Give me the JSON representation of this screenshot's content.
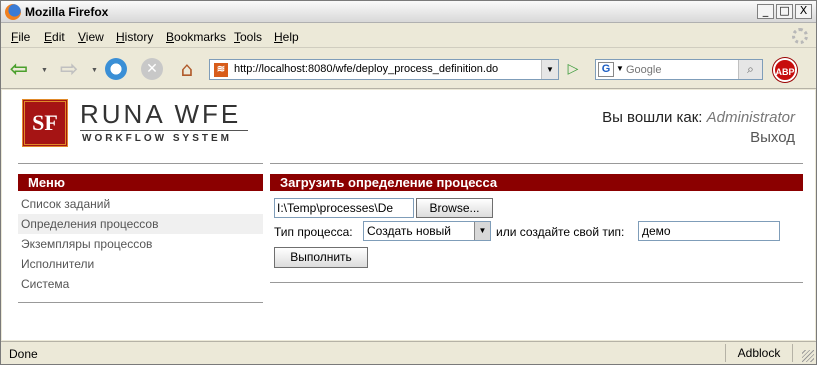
{
  "window": {
    "title": "Mozilla Firefox",
    "min": "_",
    "max": "□",
    "close": "X"
  },
  "menu": [
    {
      "label": "File",
      "key": "F",
      "rest": "ile"
    },
    {
      "label": "Edit",
      "key": "E",
      "rest": "dit"
    },
    {
      "label": "View",
      "key": "V",
      "rest": "iew"
    },
    {
      "label": "History",
      "key": "H",
      "rest": "istory"
    },
    {
      "label": "Bookmarks",
      "key": "B",
      "rest": "ookmarks"
    },
    {
      "label": "Tools",
      "key": "T",
      "rest": "ools"
    },
    {
      "label": "Help",
      "key": "H",
      "rest": "elp"
    }
  ],
  "nav": {
    "url": "http://localhost:8080/wfe/deploy_process_definition.do",
    "search_placeholder": "Google",
    "search_engine_letter": "G",
    "abp": "ABP"
  },
  "logo": {
    "mark": "SF",
    "name": "RUNA WFE",
    "subtitle": "WORKFLOW SYSTEM"
  },
  "user": {
    "prefix": "Вы вошли как:",
    "name": "Administrator",
    "logout": "Выход"
  },
  "sidebar": {
    "title": "Меню",
    "items": [
      {
        "label": "Список заданий",
        "active": false
      },
      {
        "label": "Определения процессов",
        "active": true
      },
      {
        "label": "Экземпляры процессов",
        "active": false
      },
      {
        "label": "Исполнители",
        "active": false
      },
      {
        "label": "Система",
        "active": false
      }
    ]
  },
  "main": {
    "title": "Загрузить определение процесса",
    "file_value": "I:\\Temp\\processes\\De",
    "browse_label": "Browse...",
    "type_label": "Тип процесса:",
    "type_selected": "Создать новый",
    "own_type_label": "или создайте свой тип:",
    "own_type_value": "демо",
    "submit_label": "Выполнить"
  },
  "status": {
    "text": "Done",
    "adblock": "Adblock"
  }
}
